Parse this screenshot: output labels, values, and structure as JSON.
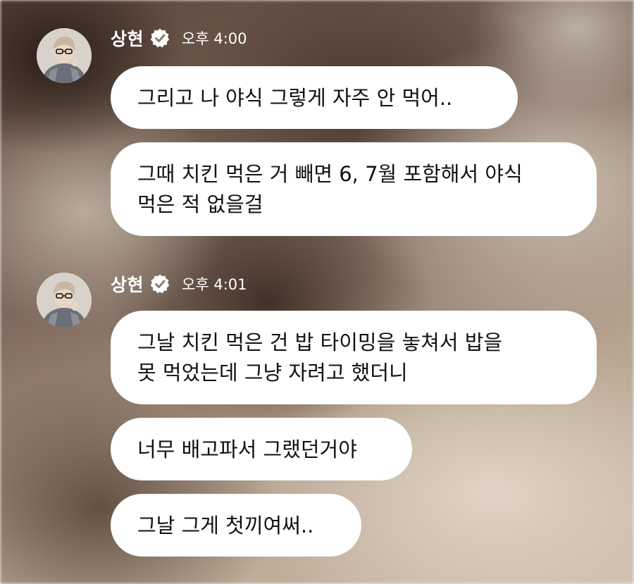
{
  "messages_group_1": {
    "sender": "상현",
    "time": "오후 4:00",
    "avatar_icon": "user-avatar-icon",
    "bubbles": [
      {
        "lines": [
          "그리고 나 야식 그렇게 자주 안 먹어.."
        ]
      },
      {
        "lines": [
          "그때 치킨 먹은 거 빼면 6, 7월 포함해서 야식",
          "먹은 적 없을걸"
        ]
      }
    ]
  },
  "messages_group_2": {
    "sender": "상현",
    "time": "오후 4:01",
    "avatar_icon": "user-avatar-icon",
    "bubbles": [
      {
        "lines": [
          "그날 치킨 먹은 건 밥 타이밍을 놓쳐서 밥을",
          "못 먹었는데 그냥 자려고 했더니"
        ]
      },
      {
        "lines": [
          "너무 배고파서 그랬던거야"
        ]
      },
      {
        "lines": [
          "그날 그게 첫끼여써.."
        ]
      }
    ]
  },
  "colors": {
    "bubble_bg": "#ffffff",
    "bubble_text": "#111111",
    "header_text": "#ffffff"
  }
}
